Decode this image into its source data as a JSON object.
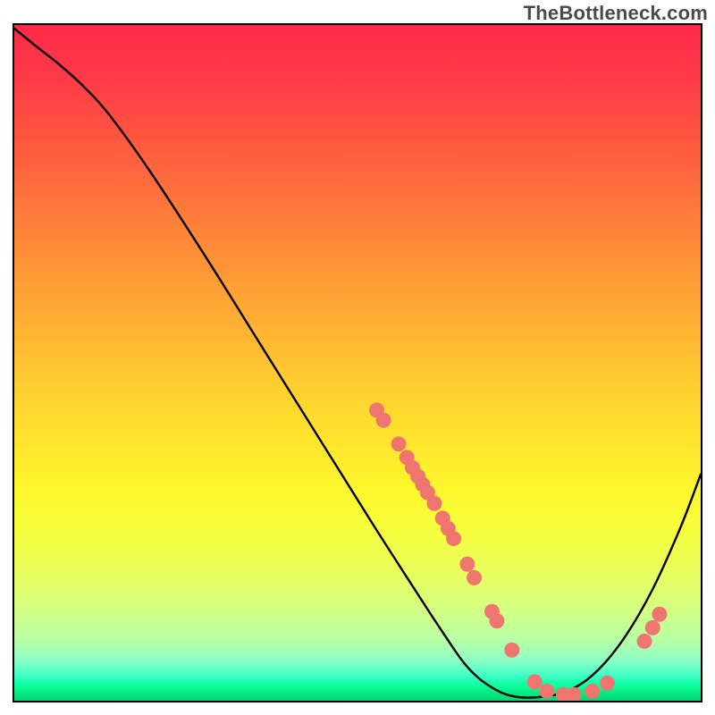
{
  "watermark": "TheBottleneck.com",
  "chart_data": {
    "type": "line",
    "title": "",
    "xlabel": "",
    "ylabel": "",
    "xlim": [
      0,
      100
    ],
    "ylim": [
      0,
      100
    ],
    "grid": false,
    "legend": false,
    "curve_points": [
      {
        "x": 0.0,
        "y": 99.5
      },
      {
        "x": 3.0,
        "y": 97.0
      },
      {
        "x": 6.5,
        "y": 94.2
      },
      {
        "x": 10.0,
        "y": 91.0
      },
      {
        "x": 14.0,
        "y": 86.5
      },
      {
        "x": 20.0,
        "y": 78.0
      },
      {
        "x": 28.0,
        "y": 65.5
      },
      {
        "x": 36.0,
        "y": 52.5
      },
      {
        "x": 44.0,
        "y": 39.5
      },
      {
        "x": 52.0,
        "y": 26.5
      },
      {
        "x": 58.0,
        "y": 17.0
      },
      {
        "x": 62.5,
        "y": 10.0
      },
      {
        "x": 66.0,
        "y": 5.0
      },
      {
        "x": 69.5,
        "y": 2.0
      },
      {
        "x": 73.0,
        "y": 0.6
      },
      {
        "x": 77.0,
        "y": 0.6
      },
      {
        "x": 81.0,
        "y": 1.6
      },
      {
        "x": 85.0,
        "y": 4.5
      },
      {
        "x": 89.0,
        "y": 9.5
      },
      {
        "x": 93.0,
        "y": 16.5
      },
      {
        "x": 97.0,
        "y": 25.5
      },
      {
        "x": 100.0,
        "y": 33.5
      }
    ],
    "marker_color": "#ee766e",
    "markers": [
      {
        "x": 52.8,
        "y": 43.0
      },
      {
        "x": 53.8,
        "y": 41.5
      },
      {
        "x": 56.0,
        "y": 38.0
      },
      {
        "x": 57.2,
        "y": 36.0
      },
      {
        "x": 58.0,
        "y": 34.5
      },
      {
        "x": 58.8,
        "y": 33.2
      },
      {
        "x": 59.5,
        "y": 32.0
      },
      {
        "x": 60.2,
        "y": 30.8
      },
      {
        "x": 61.2,
        "y": 29.2
      },
      {
        "x": 62.4,
        "y": 27.0
      },
      {
        "x": 63.2,
        "y": 25.5
      },
      {
        "x": 64.0,
        "y": 24.0
      },
      {
        "x": 66.0,
        "y": 20.2
      },
      {
        "x": 67.0,
        "y": 18.2
      },
      {
        "x": 69.6,
        "y": 13.2
      },
      {
        "x": 70.3,
        "y": 11.8
      },
      {
        "x": 72.5,
        "y": 7.5
      },
      {
        "x": 75.8,
        "y": 2.8
      },
      {
        "x": 77.6,
        "y": 1.4
      },
      {
        "x": 80.0,
        "y": 0.9
      },
      {
        "x": 81.5,
        "y": 0.9
      },
      {
        "x": 84.2,
        "y": 1.4
      },
      {
        "x": 86.4,
        "y": 2.6
      },
      {
        "x": 91.8,
        "y": 8.8
      },
      {
        "x": 93.0,
        "y": 10.8
      },
      {
        "x": 94.0,
        "y": 12.8
      }
    ],
    "marker_radius": 8.5
  }
}
